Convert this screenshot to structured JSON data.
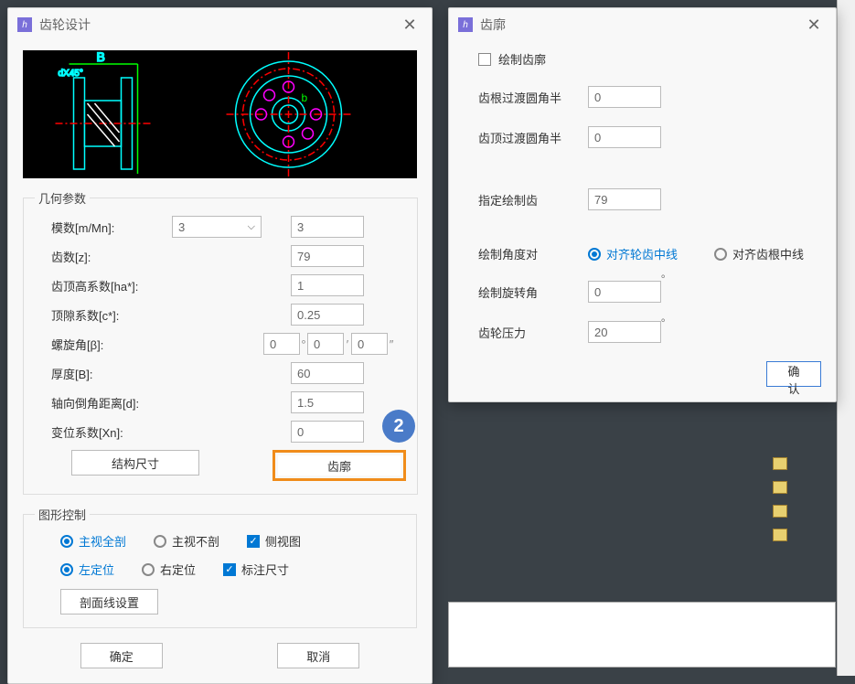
{
  "gearDesign": {
    "title": "齿轮设计",
    "section_geom": "几何参数",
    "labels": {
      "modulus": "模数[m/Mn]:",
      "teeth": "齿数[z]:",
      "addendum": "齿顶高系数[ha*]:",
      "clearance": "顶隙系数[c*]:",
      "helix": "螺旋角[β]:",
      "thickness": "厚度[B]:",
      "chamfer": "轴向倒角距离[d]:",
      "shift": "变位系数[Xn]:"
    },
    "values": {
      "modulus_sel": "3",
      "modulus_val": "3",
      "teeth": "79",
      "addendum": "1",
      "clearance": "0.25",
      "helix_deg": "0",
      "helix_min": "0",
      "helix_sec": "0",
      "thickness": "60",
      "chamfer": "1.5",
      "shift": "0"
    },
    "btn_structure": "结构尺寸",
    "btn_profile": "齿廓",
    "section_graphic": "图形控制",
    "radios": {
      "full_section": "主视全剖",
      "no_section": "主视不剖",
      "side_view": "侧视图",
      "left_align": "左定位",
      "right_align": "右定位",
      "dim_label": "标注尺寸"
    },
    "btn_hatch": "剖面线设置",
    "btn_ok": "确定",
    "btn_cancel": "取消",
    "callout": "2"
  },
  "toothProfile": {
    "title": "齿廓",
    "chk_draw": "绘制齿廓",
    "labels": {
      "root_fillet": "齿根过渡圆角半",
      "tip_fillet": "齿顶过渡圆角半",
      "spec_teeth": "指定绘制齿",
      "angle_align": "绘制角度对",
      "rot_angle": "绘制旋转角",
      "pressure": "齿轮压力"
    },
    "values": {
      "root_fillet": "0",
      "tip_fillet": "0",
      "spec_teeth": "79",
      "rot_angle": "0",
      "pressure": "20"
    },
    "radio_align_center": "对齐轮齿中线",
    "radio_align_root": "对齐齿根中线",
    "btn_ok": "确认"
  }
}
